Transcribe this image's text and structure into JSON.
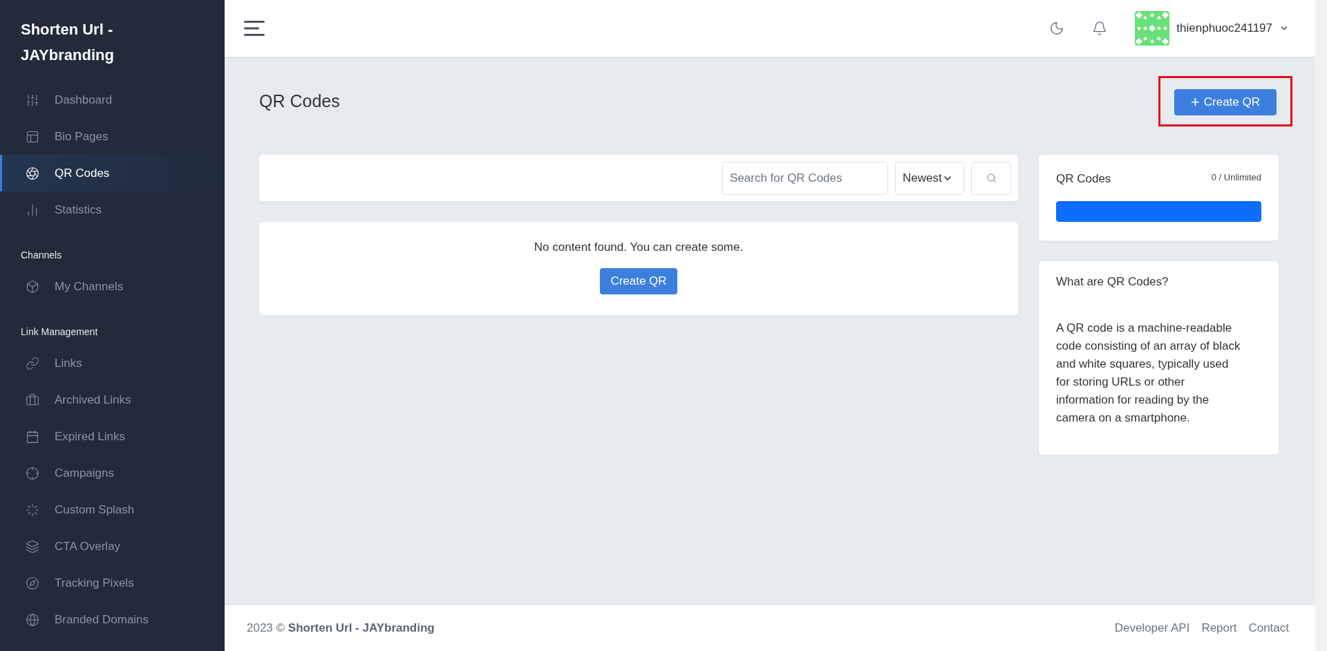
{
  "sidebar": {
    "brand": "Shorten Url - JAYbranding",
    "sections": [
      {
        "items": [
          {
            "label": "Dashboard",
            "selected": false
          },
          {
            "label": "Bio Pages",
            "selected": false
          },
          {
            "label": "QR Codes",
            "selected": true
          },
          {
            "label": "Statistics",
            "selected": false
          }
        ]
      },
      {
        "heading": "Channels",
        "items": [
          {
            "label": "My Channels",
            "selected": false
          }
        ]
      },
      {
        "heading": "Link Management",
        "items": [
          {
            "label": "Links",
            "selected": false
          },
          {
            "label": "Archived Links",
            "selected": false
          },
          {
            "label": "Expired Links",
            "selected": false
          },
          {
            "label": "Campaigns",
            "selected": false
          },
          {
            "label": "Custom Splash",
            "selected": false
          },
          {
            "label": "CTA Overlay",
            "selected": false
          },
          {
            "label": "Tracking Pixels",
            "selected": false
          },
          {
            "label": "Branded Domains",
            "selected": false
          }
        ]
      }
    ]
  },
  "header": {
    "username": "thienphuoc241197"
  },
  "page": {
    "title": "QR Codes",
    "create_button": {
      "icon_text": "+",
      "label": "Create QR",
      "highlighted": true
    }
  },
  "filter": {
    "search_placeholder": "Search for QR Codes",
    "sort_value": "Newest"
  },
  "empty_state": {
    "message": "No content found. You can create some.",
    "button": "Create QR"
  },
  "usage_card": {
    "title": "QR Codes",
    "count": "0 / Unlimited",
    "level": 1
  },
  "info_card": {
    "title": "What are QR Codes?",
    "body": "A QR code is a machine-readable code consisting of an array of black and white squares, typically used for storing URLs or other information for reading by the camera on a smartphone."
  },
  "footer": {
    "year": "2023 ©",
    "brand": "Shorten Url - JAYbranding",
    "links": [
      "Developer API",
      "Report",
      "Contact"
    ]
  }
}
